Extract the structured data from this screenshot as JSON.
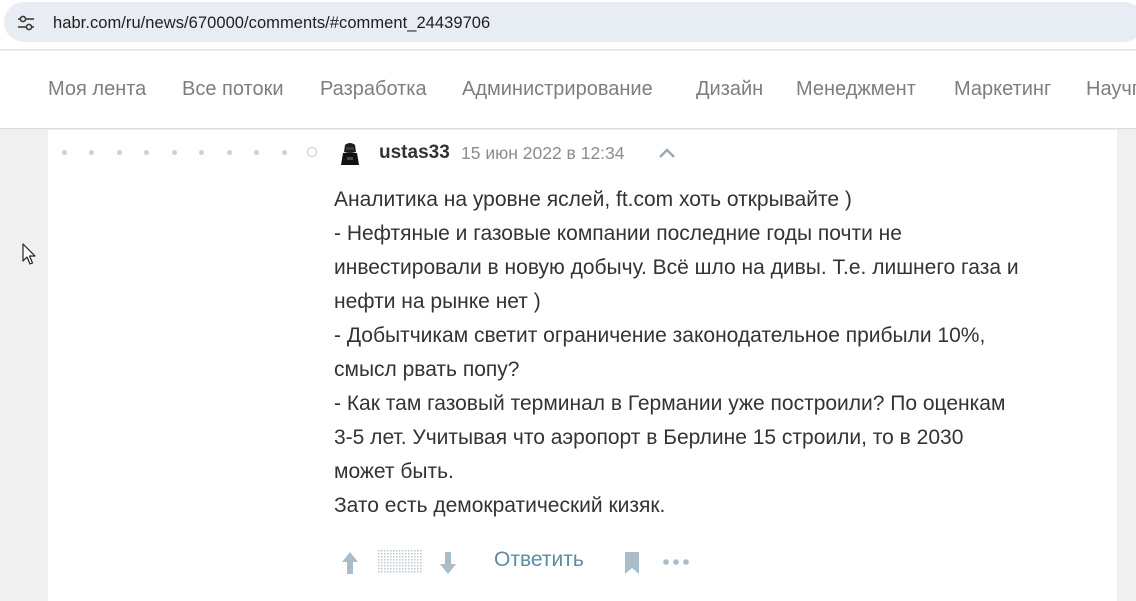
{
  "browser": {
    "url": "habr.com/ru/news/670000/comments/#comment_24439706",
    "site_info_icon": "tune-icon"
  },
  "nav": {
    "items": [
      {
        "label": "Моя лента"
      },
      {
        "label": "Все потоки"
      },
      {
        "label": "Разработка"
      },
      {
        "label": "Администрирование"
      },
      {
        "label": "Дизайн"
      },
      {
        "label": "Менеджмент"
      },
      {
        "label": "Маркетинг"
      },
      {
        "label": "Научпоп"
      }
    ]
  },
  "comment": {
    "username": "ustas33",
    "timestamp": "15 июн 2022 в 12:34",
    "lines": [
      "Аналитика на уровне яслей, ft.com хоть открывайте )",
      "- Нефтяные и газовые компании последние годы почти не",
      "инвестировали в новую добычу. Всё шло на дивы. Т.е. лишнего газа и",
      "нефти на рынке нет )",
      "- Добытчикам светит ограничение законодательное прибыли 10%,",
      "смысл рвать попу?",
      "- Как там газовый терминал в Германии уже построили? По оценкам",
      "3-5 лет. Учитывая что аэропорт в Берлине 15 строили, то в 2030",
      "может быть.",
      "Зато есть демократический кизяк."
    ],
    "actions": {
      "reply_label": "Ответить",
      "upvote_icon": "arrow-up-icon",
      "downvote_icon": "arrow-down-icon",
      "bookmark_icon": "bookmark-icon",
      "more_icon": "more-dots-icon"
    }
  },
  "colors": {
    "nav_text": "#7e7e7e",
    "body_text": "#333333",
    "reply_link": "#5e8ba6",
    "vote_icon": "#a9bcc9",
    "page_background": "#f0f0f0"
  }
}
